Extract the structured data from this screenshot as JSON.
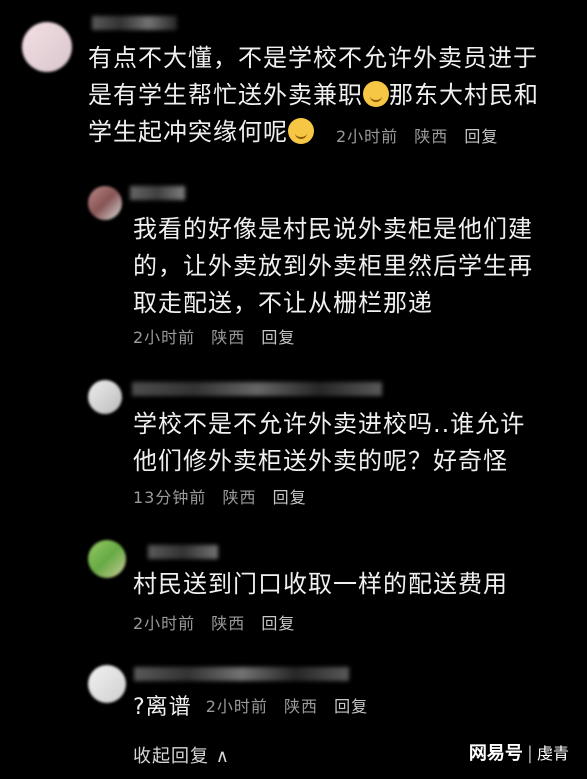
{
  "comments": [
    {
      "text_lines": [
        "有点不大懂，不是学校不允许外卖员进于",
        "是有学生帮忙送外卖兼职",
        "那东大村民和",
        "学生起冲突缘何呢"
      ],
      "time": "2小时前",
      "location": "陕西",
      "reply_label": "回复",
      "emoji_names": [
        "thinking-emoji",
        "thinking-emoji"
      ]
    },
    {
      "text_lines": [
        "我看的好像是村民说外卖柜是他们建",
        "的，让外卖放到外卖柜里然后学生再",
        "取走配送，不让从栅栏那递"
      ],
      "time": "2小时前",
      "location": "陕西",
      "reply_label": "回复"
    },
    {
      "text_lines": [
        "学校不是不允许外卖进校吗..谁允许",
        "他们修外卖柜送外卖的呢？好奇怪"
      ],
      "time": "13分钟前",
      "location": "陕西",
      "reply_label": "回复"
    },
    {
      "text_lines": [
        "村民送到门口收取一样的配送费用"
      ],
      "time": "2小时前",
      "location": "陕西",
      "reply_label": "回复"
    },
    {
      "text": "?离谱",
      "time": "2小时前",
      "location": "陕西",
      "reply_label": "回复"
    }
  ],
  "collapse_label": "收起回复 ∧",
  "watermark": {
    "brand": "网易号",
    "author": "虔青"
  },
  "colors": {
    "background": "#000000",
    "text": "#f0f0f0",
    "meta": "#9a9a9a"
  }
}
